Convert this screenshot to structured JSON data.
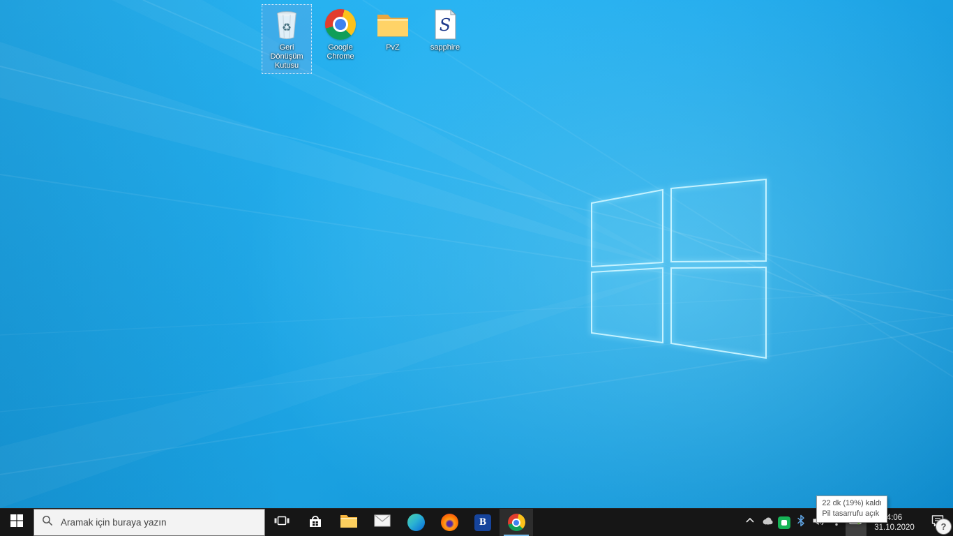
{
  "desktop": {
    "icons": [
      {
        "label": "Geri Dönüşüm Kutusu",
        "icon": "recycle-bin",
        "glyph": "♻",
        "selected": true
      },
      {
        "label": "Google Chrome",
        "icon": "chrome-logo",
        "selected": false
      },
      {
        "label": "PvZ",
        "icon": "folder",
        "selected": false
      },
      {
        "label": "sapphire",
        "icon": "document-with-s",
        "glyph": "S",
        "selected": false
      }
    ]
  },
  "taskbar": {
    "start": {
      "icon": "windows-logo"
    },
    "search": {
      "placeholder": "Aramak için buraya yazın",
      "icon": "magnifier"
    },
    "task_view": {
      "icon": "task-view"
    },
    "apps": [
      {
        "icon": "microsoft-store"
      },
      {
        "icon": "file-explorer-folder"
      },
      {
        "icon": "mail-envelope"
      },
      {
        "icon": "edge-browser"
      },
      {
        "icon": "firefox-browser"
      },
      {
        "icon": "letter-b-app",
        "glyph": "B"
      },
      {
        "icon": "chrome-browser",
        "active": true
      }
    ],
    "tray": {
      "icons": [
        "chevron-up",
        "cloud",
        "green-app",
        "bluetooth",
        "volume",
        "wifi",
        "battery-saver"
      ],
      "clock": {
        "time": "4:06",
        "date": "31.10.2020"
      },
      "action_center_icon": "notification-bubble",
      "tooltip": {
        "line1": "22 dk (19%) kaldı",
        "line2": "Pil tasarrufu açık"
      }
    },
    "help_badge": "?"
  },
  "colors": {
    "wallpaper_blue": "#14a6ec",
    "taskbar_bg": "#161616",
    "accent": "#0078d7",
    "selection_fill": "rgba(105,165,225,0.35)",
    "tooltip_bg": "#ffffff"
  }
}
